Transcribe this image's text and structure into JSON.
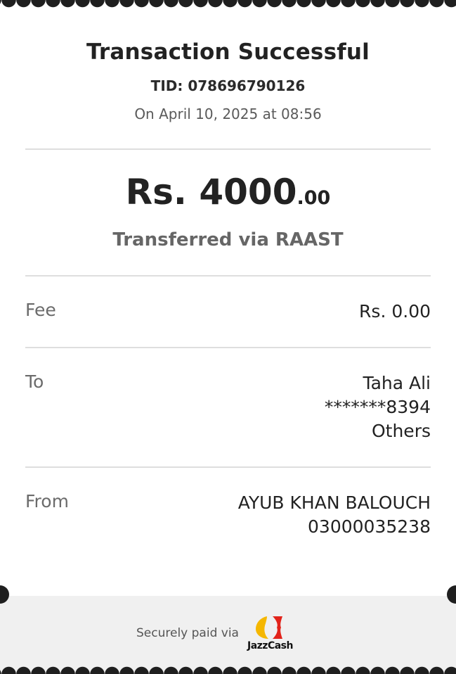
{
  "header": {
    "title": "Transaction Successful",
    "tid": "TID: 078696790126",
    "date": "On April 10, 2025 at 08:56"
  },
  "amount": {
    "main": "Rs. 4000",
    "decimal": ".00",
    "via": "Transferred via RAAST"
  },
  "fee": {
    "label": "Fee",
    "value": "Rs. 0.00"
  },
  "to": {
    "label": "To",
    "name": "Taha Ali",
    "account": "*******8394",
    "bank": "Others"
  },
  "from": {
    "label": "From",
    "name": "AYUB KHAN BALOUCH",
    "number": "03000035238"
  },
  "footer": {
    "secure_text": "Securely paid via",
    "brand": "JazzCash"
  },
  "colors": {
    "logo_yellow": "#f5b700",
    "logo_red": "#e2231a",
    "footer_bg": "#f0f0f0"
  }
}
